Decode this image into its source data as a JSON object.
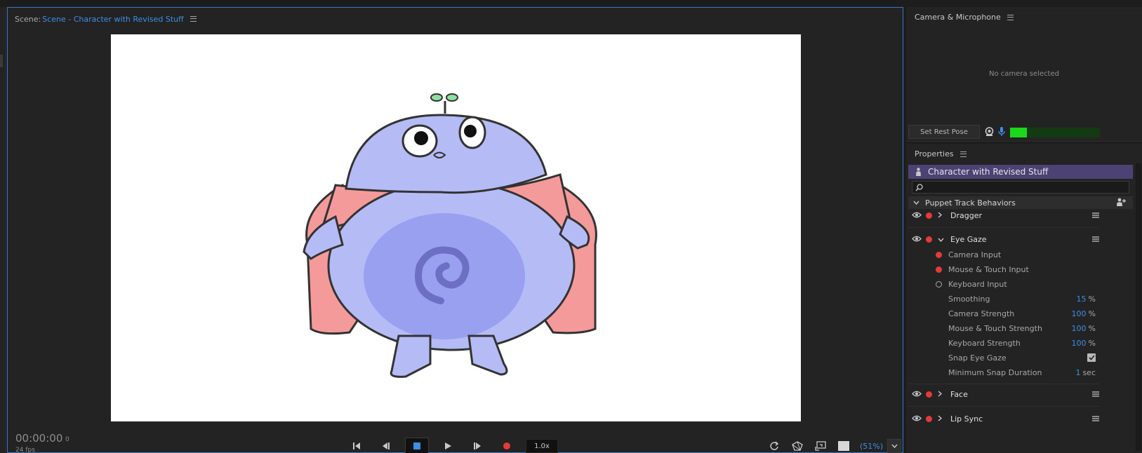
{
  "scene": {
    "label": "Scene:",
    "name": "Scene - Character with Revised Stuff"
  },
  "timeline": {
    "timecode": "00:00:00",
    "frame": "0",
    "fps": "24 fps",
    "speed": "1.0x",
    "zoom": "(51%)"
  },
  "camera_panel": {
    "title": "Camera & Microphone",
    "status": "No camera selected",
    "rest_pose_button": "Set Rest Pose",
    "mic_level": 0.19
  },
  "properties": {
    "title": "Properties",
    "puppet_name": "Character with Revised Stuff",
    "search_value": "",
    "section_title": "Puppet Track Behaviors",
    "behaviors": {
      "dragger": "Dragger",
      "eye_gaze": "Eye Gaze",
      "face": "Face",
      "lip_sync": "Lip Sync"
    },
    "eye_gaze_params": {
      "camera_input": "Camera Input",
      "mouse_touch_input": "Mouse & Touch Input",
      "keyboard_input": "Keyboard Input",
      "smoothing": {
        "label": "Smoothing",
        "value": "15",
        "unit": "%"
      },
      "camera_strength": {
        "label": "Camera Strength",
        "value": "100",
        "unit": "%"
      },
      "mouse_touch_strength": {
        "label": "Mouse & Touch Strength",
        "value": "100",
        "unit": "%"
      },
      "keyboard_strength": {
        "label": "Keyboard Strength",
        "value": "100",
        "unit": "%"
      },
      "snap_eye_gaze": {
        "label": "Snap Eye Gaze",
        "checked": true
      },
      "min_snap_duration": {
        "label": "Minimum Snap Duration",
        "value": "1",
        "unit": "sec"
      }
    }
  },
  "colors": {
    "accent_blue": "#3d8ee6",
    "record_red": "#e53a3a",
    "meter_green": "#1bd81b",
    "puppet_bar": "#4c4374"
  }
}
